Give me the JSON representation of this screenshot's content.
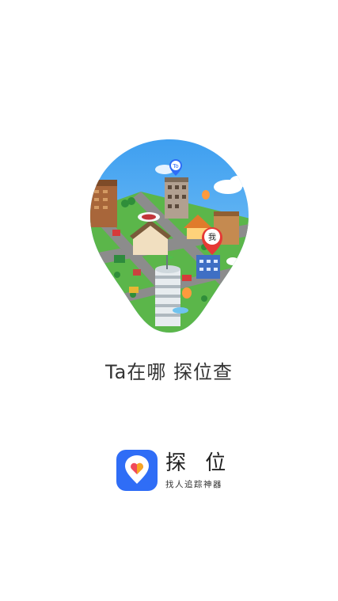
{
  "splash": {
    "tagline": "Ta在哪 探位查",
    "pins": {
      "other_label": "To",
      "me_label": "我"
    }
  },
  "brand": {
    "app_name": "探 位",
    "slogan": "找人追踪神器",
    "icon": "location-heart-icon"
  },
  "colors": {
    "accent": "#2f6df6",
    "ground": "#5bb64a",
    "sky": "#4fa8f0",
    "road": "#8c8c8c"
  }
}
